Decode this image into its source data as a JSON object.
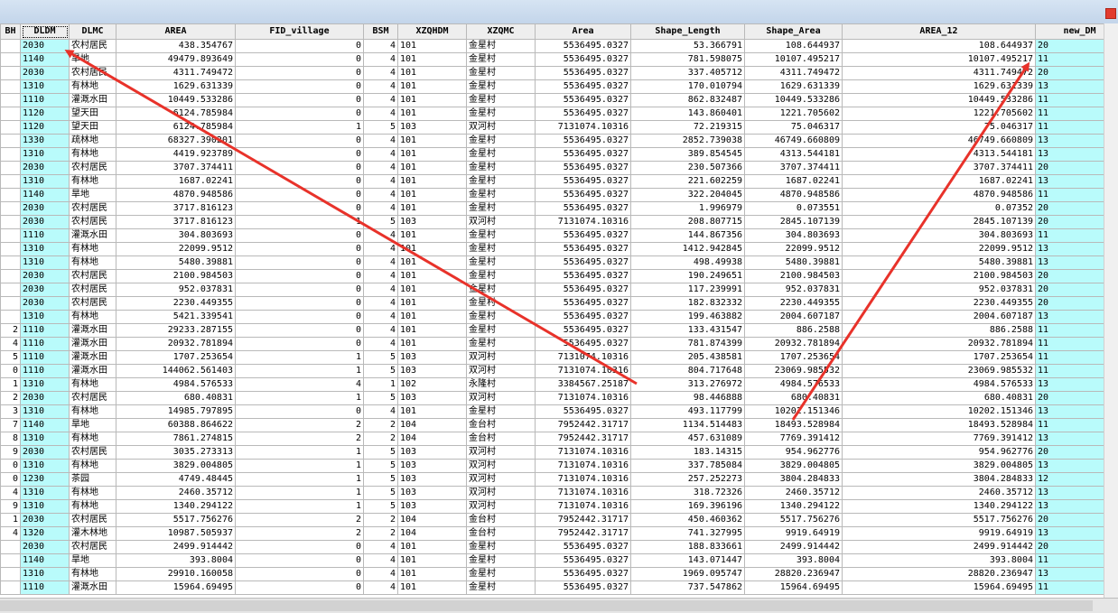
{
  "columns": [
    "BH",
    "DLDM",
    "DLMC",
    "AREA",
    "FID_village",
    "BSM",
    "XZQHDM",
    "XZQMC",
    "Area",
    "Shape_Length",
    "Shape_Area",
    "AREA_12",
    "new_DM"
  ],
  "column_widths": [
    22,
    54,
    52,
    132,
    142,
    38,
    76,
    76,
    106,
    126,
    108,
    214,
    98
  ],
  "rows": [
    [
      "",
      "2030",
      "农村居民",
      "438.354767",
      "0",
      "4",
      "101",
      "金星村",
      "5536495.0327",
      "53.366791",
      "108.644937",
      "108.644937",
      "20"
    ],
    [
      "",
      "1140",
      "旱地",
      "49479.893649",
      "0",
      "4",
      "101",
      "金星村",
      "5536495.0327",
      "781.598075",
      "10107.495217",
      "10107.495217",
      "11"
    ],
    [
      "",
      "2030",
      "农村居民",
      "4311.749472",
      "0",
      "4",
      "101",
      "金星村",
      "5536495.0327",
      "337.405712",
      "4311.749472",
      "4311.749472",
      "20"
    ],
    [
      "",
      "1310",
      "有林地",
      "1629.631339",
      "0",
      "4",
      "101",
      "金星村",
      "5536495.0327",
      "170.010794",
      "1629.631339",
      "1629.631339",
      "13"
    ],
    [
      "",
      "1110",
      "灌溉水田",
      "10449.533286",
      "0",
      "4",
      "101",
      "金星村",
      "5536495.0327",
      "862.832487",
      "10449.533286",
      "10449.533286",
      "11"
    ],
    [
      "",
      "1120",
      "望天田",
      "6124.785984",
      "0",
      "4",
      "101",
      "金星村",
      "5536495.0327",
      "143.860401",
      "1221.705602",
      "1221.705602",
      "11"
    ],
    [
      "",
      "1120",
      "望天田",
      "6124.785984",
      "1",
      "5",
      "103",
      "双河村",
      "7131074.10316",
      "72.219315",
      "75.046317",
      "75.046317",
      "11"
    ],
    [
      "",
      "1330",
      "疏林地",
      "68327.390201",
      "0",
      "4",
      "101",
      "金星村",
      "5536495.0327",
      "2852.739038",
      "46749.660809",
      "46749.660809",
      "13"
    ],
    [
      "",
      "1310",
      "有林地",
      "4419.923789",
      "0",
      "4",
      "101",
      "金星村",
      "5536495.0327",
      "389.854545",
      "4313.544181",
      "4313.544181",
      "13"
    ],
    [
      "",
      "2030",
      "农村居民",
      "3707.374411",
      "0",
      "4",
      "101",
      "金星村",
      "5536495.0327",
      "230.507366",
      "3707.374411",
      "3707.374411",
      "20"
    ],
    [
      "",
      "1310",
      "有林地",
      "1687.02241",
      "0",
      "4",
      "101",
      "金星村",
      "5536495.0327",
      "221.602259",
      "1687.02241",
      "1687.02241",
      "13"
    ],
    [
      "",
      "1140",
      "旱地",
      "4870.948586",
      "0",
      "4",
      "101",
      "金星村",
      "5536495.0327",
      "322.204045",
      "4870.948586",
      "4870.948586",
      "11"
    ],
    [
      "",
      "2030",
      "农村居民",
      "3717.816123",
      "0",
      "4",
      "101",
      "金星村",
      "5536495.0327",
      "1.996979",
      "0.073551",
      "0.07352",
      "20"
    ],
    [
      "",
      "2030",
      "农村居民",
      "3717.816123",
      "1",
      "5",
      "103",
      "双河村",
      "7131074.10316",
      "208.807715",
      "2845.107139",
      "2845.107139",
      "20"
    ],
    [
      "",
      "1110",
      "灌溉水田",
      "304.803693",
      "0",
      "4",
      "101",
      "金星村",
      "5536495.0327",
      "144.867356",
      "304.803693",
      "304.803693",
      "11"
    ],
    [
      "",
      "1310",
      "有林地",
      "22099.9512",
      "0",
      "4",
      "101",
      "金星村",
      "5536495.0327",
      "1412.942845",
      "22099.9512",
      "22099.9512",
      "13"
    ],
    [
      "",
      "1310",
      "有林地",
      "5480.39881",
      "0",
      "4",
      "101",
      "金星村",
      "5536495.0327",
      "498.49938",
      "5480.39881",
      "5480.39881",
      "13"
    ],
    [
      "",
      "2030",
      "农村居民",
      "2100.984503",
      "0",
      "4",
      "101",
      "金星村",
      "5536495.0327",
      "190.249651",
      "2100.984503",
      "2100.984503",
      "20"
    ],
    [
      "",
      "2030",
      "农村居民",
      "952.037831",
      "0",
      "4",
      "101",
      "金星村",
      "5536495.0327",
      "117.239991",
      "952.037831",
      "952.037831",
      "20"
    ],
    [
      "",
      "2030",
      "农村居民",
      "2230.449355",
      "0",
      "4",
      "101",
      "金星村",
      "5536495.0327",
      "182.832332",
      "2230.449355",
      "2230.449355",
      "20"
    ],
    [
      "",
      "1310",
      "有林地",
      "5421.339541",
      "0",
      "4",
      "101",
      "金星村",
      "5536495.0327",
      "199.463882",
      "2004.607187",
      "2004.607187",
      "13"
    ],
    [
      "2",
      "1110",
      "灌溉水田",
      "29233.287155",
      "0",
      "4",
      "101",
      "金星村",
      "5536495.0327",
      "133.431547",
      "886.2588",
      "886.2588",
      "11"
    ],
    [
      "4",
      "1110",
      "灌溉水田",
      "20932.781894",
      "0",
      "4",
      "101",
      "金星村",
      "5536495.0327",
      "781.874399",
      "20932.781894",
      "20932.781894",
      "11"
    ],
    [
      "5",
      "1110",
      "灌溉水田",
      "1707.253654",
      "1",
      "5",
      "103",
      "双河村",
      "7131074.10316",
      "205.438581",
      "1707.253654",
      "1707.253654",
      "11"
    ],
    [
      "0",
      "1110",
      "灌溉水田",
      "144062.561403",
      "1",
      "5",
      "103",
      "双河村",
      "7131074.10316",
      "804.717648",
      "23069.985532",
      "23069.985532",
      "11"
    ],
    [
      "1",
      "1310",
      "有林地",
      "4984.576533",
      "4",
      "1",
      "102",
      "永隆村",
      "3384567.25187",
      "313.276972",
      "4984.576533",
      "4984.576533",
      "13"
    ],
    [
      "2",
      "2030",
      "农村居民",
      "680.40831",
      "1",
      "5",
      "103",
      "双河村",
      "7131074.10316",
      "98.446888",
      "680.40831",
      "680.40831",
      "20"
    ],
    [
      "3",
      "1310",
      "有林地",
      "14985.797895",
      "0",
      "4",
      "101",
      "金星村",
      "5536495.0327",
      "493.117799",
      "10202.151346",
      "10202.151346",
      "13"
    ],
    [
      "7",
      "1140",
      "旱地",
      "60388.864622",
      "2",
      "2",
      "104",
      "金台村",
      "7952442.31717",
      "1134.514483",
      "18493.528984",
      "18493.528984",
      "11"
    ],
    [
      "8",
      "1310",
      "有林地",
      "7861.274815",
      "2",
      "2",
      "104",
      "金台村",
      "7952442.31717",
      "457.631089",
      "7769.391412",
      "7769.391412",
      "13"
    ],
    [
      "9",
      "2030",
      "农村居民",
      "3035.273313",
      "1",
      "5",
      "103",
      "双河村",
      "7131074.10316",
      "183.14315",
      "954.962776",
      "954.962776",
      "20"
    ],
    [
      "0",
      "1310",
      "有林地",
      "3829.004805",
      "1",
      "5",
      "103",
      "双河村",
      "7131074.10316",
      "337.785084",
      "3829.004805",
      "3829.004805",
      "13"
    ],
    [
      "0",
      "1230",
      "茶园",
      "4749.48445",
      "1",
      "5",
      "103",
      "双河村",
      "7131074.10316",
      "257.252273",
      "3804.284833",
      "3804.284833",
      "12"
    ],
    [
      "4",
      "1310",
      "有林地",
      "2460.35712",
      "1",
      "5",
      "103",
      "双河村",
      "7131074.10316",
      "318.72326",
      "2460.35712",
      "2460.35712",
      "13"
    ],
    [
      "9",
      "1310",
      "有林地",
      "1340.294122",
      "1",
      "5",
      "103",
      "双河村",
      "7131074.10316",
      "169.396196",
      "1340.294122",
      "1340.294122",
      "13"
    ],
    [
      "1",
      "2030",
      "农村居民",
      "5517.756276",
      "2",
      "2",
      "104",
      "金台村",
      "7952442.31717",
      "450.460362",
      "5517.756276",
      "5517.756276",
      "20"
    ],
    [
      "4",
      "1320",
      "灌木林地",
      "10987.505937",
      "2",
      "2",
      "104",
      "金台村",
      "7952442.31717",
      "741.327995",
      "9919.64919",
      "9919.64919",
      "13"
    ],
    [
      "",
      "2030",
      "农村居民",
      "2499.914442",
      "0",
      "4",
      "101",
      "金星村",
      "5536495.0327",
      "188.833661",
      "2499.914442",
      "2499.914442",
      "20"
    ],
    [
      "",
      "1140",
      "旱地",
      "393.8004",
      "0",
      "4",
      "101",
      "金星村",
      "5536495.0327",
      "143.071447",
      "393.8004",
      "393.8004",
      "11"
    ],
    [
      "",
      "1310",
      "有林地",
      "29910.160058",
      "0",
      "4",
      "101",
      "金星村",
      "5536495.0327",
      "1969.095747",
      "28820.236947",
      "28820.236947",
      "13"
    ],
    [
      "",
      "1110",
      "灌溉水田",
      "15964.69495",
      "0",
      "4",
      "101",
      "金星村",
      "5536495.0327",
      "737.547862",
      "15964.69495",
      "15964.69495",
      "11"
    ]
  ],
  "colors": {
    "highlight": "#b9fbfb",
    "arrow": "#e8322a",
    "header": "#eeeeee"
  }
}
